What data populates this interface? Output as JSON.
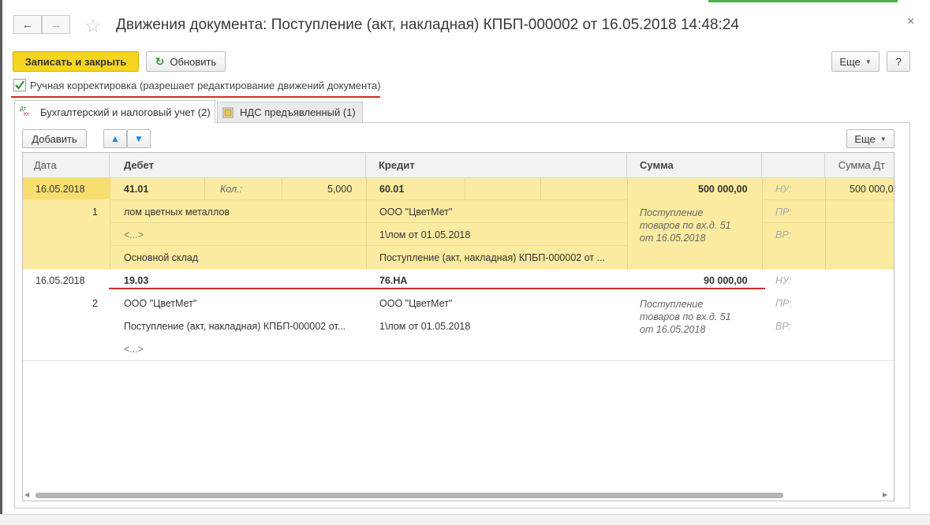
{
  "window": {
    "title": "Движения документа: Поступление (акт, накладная) КПБП-000002 от 16.05.2018 14:48:24",
    "back_icon": "←",
    "forward_icon": "→",
    "star_icon": "☆",
    "close_icon": "×"
  },
  "toolbar": {
    "save_close_label": "Записать и закрыть",
    "refresh_label": "Обновить",
    "more_label": "Еще",
    "help_label": "?"
  },
  "manual": {
    "label": "Ручная корректировка (разрешает редактирование движений документа)",
    "checked": true
  },
  "tabs": [
    {
      "label": "Бухгалтерский и налоговый учет (2)",
      "icon_top": "Дт",
      "icon_bottom": "Кт"
    },
    {
      "label": "НДС предъявленный (1)"
    }
  ],
  "table_toolbar": {
    "add_label": "Добавить",
    "more_label": "Еще",
    "up_icon": "▲",
    "down_icon": "▼"
  },
  "table": {
    "columns": [
      "Дата",
      "Дебет",
      "Кредит",
      "Сумма",
      "",
      "Сумма Дт"
    ],
    "rows": [
      {
        "date": "16.05.2018",
        "number": "1",
        "debit_account": "41.01",
        "qty_label": "Кол.:",
        "qty_value": "5,000",
        "debit_subconto1": "лом цветных металлов",
        "debit_subconto2": "<...>",
        "debit_subconto3": "Основной склад",
        "credit_account": "60.01",
        "credit_subconto1": "ООО \"ЦветМет\"",
        "credit_subconto2": "1\\лом от 01.05.2018",
        "credit_subconto3": "Поступление (акт, накладная) КПБП-000002 от ...",
        "amount": "500 000,00",
        "content": [
          "Поступление",
          "товаров по вх.д. 51",
          "от 16.05.2018"
        ],
        "nu_label": "НУ:",
        "pr_label": "ПР:",
        "vr_label": "ВР:",
        "amount_dt": "500 000,0"
      },
      {
        "date": "16.05.2018",
        "number": "2",
        "debit_account": "19.03",
        "debit_subconto1": "ООО \"ЦветМет\"",
        "debit_subconto2": "Поступление (акт, накладная) КПБП-000002 от...",
        "debit_subconto3": "<...>",
        "credit_account": "76.НА",
        "credit_subconto1": "ООО \"ЦветМет\"",
        "credit_subconto2": "1\\лом от 01.05.2018",
        "amount": "90 000,00",
        "content": [
          "Поступление",
          "товаров по вх.д. 51",
          "от 16.05.2018"
        ],
        "nu_label": "НУ:",
        "pr_label": "ПР:",
        "vr_label": "ВР:"
      }
    ]
  },
  "colors": {
    "accent_yellow": "#f5d61d",
    "selected_row": "#fbeba1",
    "highlight_red": "#d42a2a"
  }
}
